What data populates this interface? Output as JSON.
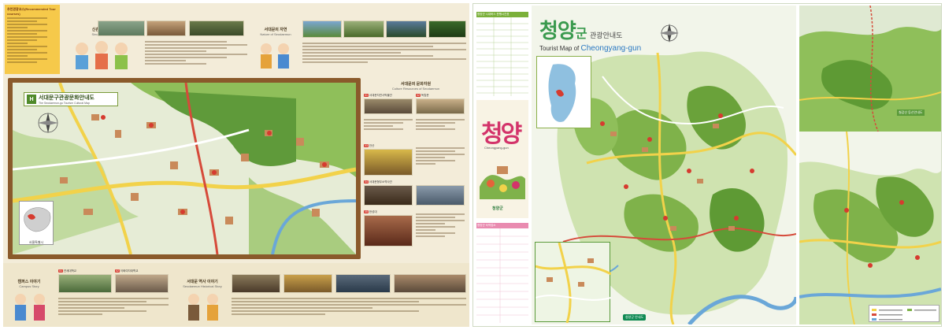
{
  "left": {
    "recommended_title": "추천관광코스(Recommended Tour courses)",
    "sinchon": {
      "ko": "신촌 이야기",
      "en": "Sinchon Story"
    },
    "nature": {
      "ko": "서대문의 자연",
      "en": "Nature of Seodaemun"
    },
    "map_title": {
      "ko": "서대문구관광문화안내도",
      "en": "The Seodaemun-gu Tourism Cultural Map"
    },
    "culture": {
      "ko": "서대문의 문화자원",
      "en": "Culture Resources of Seodaemun"
    },
    "campus": {
      "ko": "캠퍼스 이야기",
      "en": "Campus Story"
    },
    "history": {
      "ko": "서대문 역사 이야기",
      "en": "Seodaemun Historical Story"
    },
    "seoul_label": "서울특별시",
    "item_labels": [
      "신촌 물레터",
      "연세대학교",
      "서대문자연사박물관",
      "안산",
      "독립문",
      "이화여자대학교",
      "서대문형무소역사관",
      "한성대"
    ]
  },
  "right": {
    "title_ko": "청양",
    "title_gun": "군",
    "subtitle_ko": "관광안내도",
    "title_en_prefix": "Tourist Map of",
    "title_en_name": "Cheongyang-gun",
    "cover_title": "청양",
    "cover_en": "Cheongyang-gun",
    "cover_org": "청양군",
    "bus_table_title": "청양군 시내버스 운행시간표",
    "fare_table_title": "청양군 숙박업소",
    "inset_label": "칠갑산 등산안내도",
    "bottom_label": "청양군 안내도"
  },
  "colors": {
    "map_green": "#7fb24a",
    "forest_dark": "#3f7a2c",
    "road_yellow": "#f2d24a",
    "road_red": "#d64a3a",
    "river_blue": "#6aa7d8",
    "title_pink": "#d3336a",
    "title_green": "#3a9a4e",
    "frame_brown": "#8a5a2b"
  },
  "icons": [
    "compass-icon",
    "location-pin-icon",
    "mountain-icon",
    "bus-icon"
  ]
}
